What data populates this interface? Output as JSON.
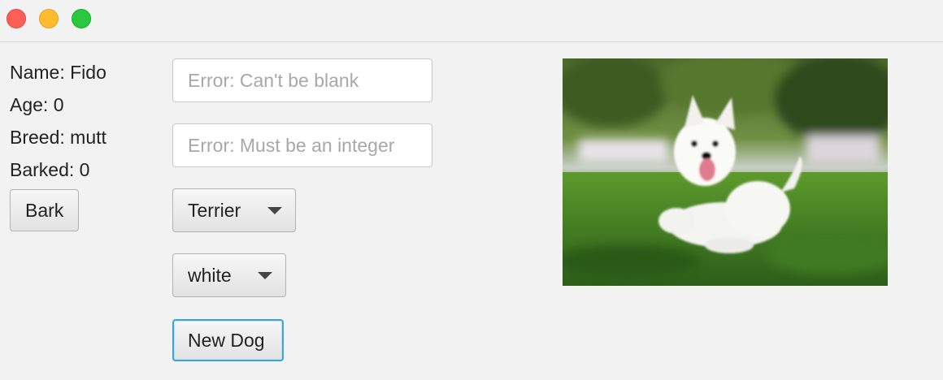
{
  "window": {
    "controls": [
      "close",
      "minimize",
      "maximize"
    ]
  },
  "dog": {
    "name_label": "Name: Fido",
    "age_label": "Age: 0",
    "breed_label": "Breed: mutt",
    "barked_label": "Barked: 0"
  },
  "bark_button": "Bark",
  "form": {
    "name_placeholder": "Error: Can't be blank",
    "age_placeholder": "Error: Must be an integer",
    "breed_selected": "Terrier",
    "color_selected": "white",
    "new_dog_button": "New Dog"
  },
  "colors": {
    "close": "#ff5f57",
    "minimize": "#febc2e",
    "maximize": "#28c840",
    "focus_border": "#3aa3d8"
  },
  "icons": {
    "dropdown": "chevron-down-icon"
  },
  "image": {
    "subject": "white terrier running on grass"
  }
}
